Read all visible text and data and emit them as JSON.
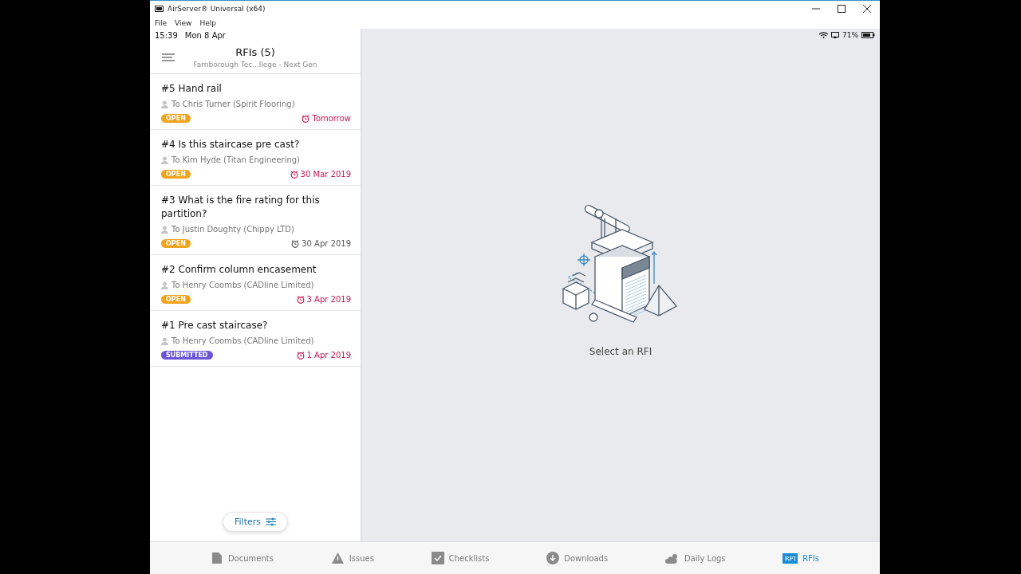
{
  "window": {
    "title": "AirServer® Universal (x64)",
    "menu": [
      "File",
      "View",
      "Help"
    ]
  },
  "status_bar": {
    "time": "15:39",
    "date": "Mon 8 Apr",
    "battery": "71%"
  },
  "header": {
    "title": "RFIs (5)",
    "subtitle": "Farnborough Tec...llege - Next Gen"
  },
  "rfis": [
    {
      "title": "#5 Hand rail",
      "assignee": "To Chris Turner (Spirit Flooring)",
      "status": "OPEN",
      "color": "#f0a31c",
      "due": "Tomorrow",
      "overdue": true
    },
    {
      "title": "#4 Is this staircase pre cast?",
      "assignee": "To Kim Hyde (Titan Engineering)",
      "status": "OPEN",
      "color": "#f0a31c",
      "due": "30 Mar 2019",
      "overdue": true
    },
    {
      "title": "#3 What is the fire rating for this partition?",
      "assignee": "To Justin Doughty (Chippy LTD)",
      "status": "OPEN",
      "color": "#f0a31c",
      "due": "30 Apr 2019",
      "overdue": false
    },
    {
      "title": "#2 Confirm column encasement",
      "assignee": "To Henry Coombs (CADline Limited)",
      "status": "OPEN",
      "color": "#f0a31c",
      "due": "3 Apr 2019",
      "overdue": true
    },
    {
      "title": "#1 Pre cast staircase?",
      "assignee": "To Henry Coombs (CADline Limited)",
      "status": "SUBMITTED",
      "color": "#6b55d6",
      "due": "1 Apr 2019",
      "overdue": true
    }
  ],
  "filters_button": "Filters",
  "empty_state": {
    "message": "Select an RFI"
  },
  "tabs": [
    {
      "kind": "documents",
      "label": "Documents",
      "selected": false
    },
    {
      "kind": "issues",
      "label": "Issues",
      "selected": false
    },
    {
      "kind": "checklists",
      "label": "Checklists",
      "selected": false
    },
    {
      "kind": "downloads",
      "label": "Downloads",
      "selected": false
    },
    {
      "kind": "daily_logs",
      "label": "Daily Logs",
      "selected": false
    },
    {
      "kind": "rfis",
      "label": "RFIs",
      "selected": true,
      "icon_text": "RFI"
    }
  ]
}
